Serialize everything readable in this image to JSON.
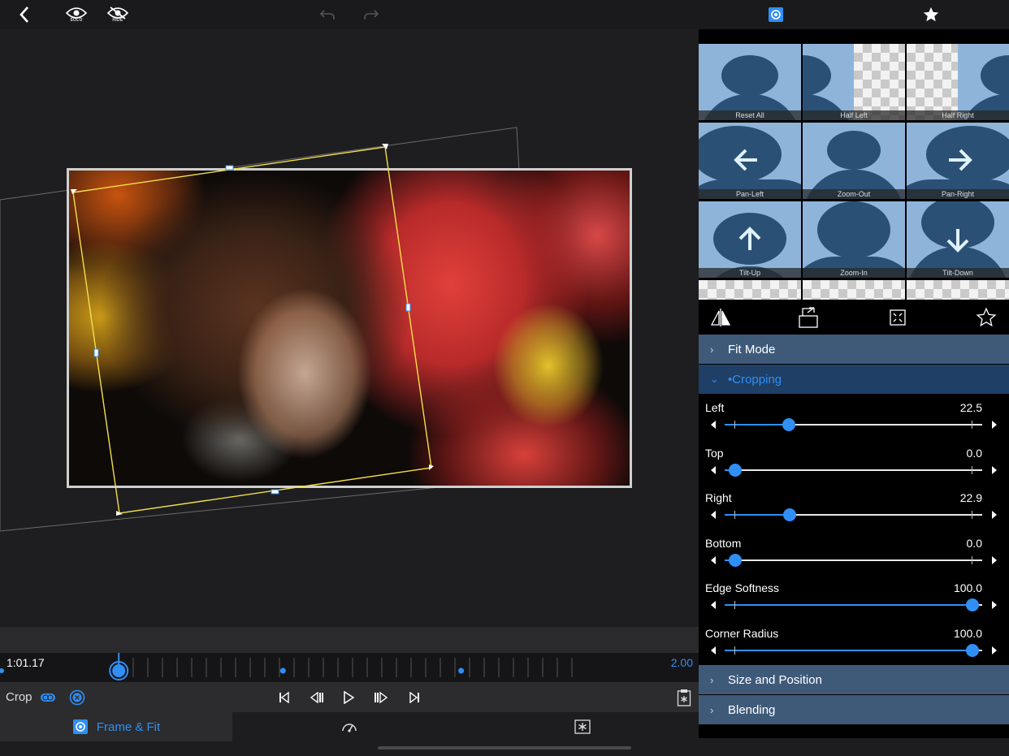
{
  "topbar": {
    "back": "back-chevron",
    "solo_label": "SOLO",
    "hide_label": "HIDE",
    "undo": "undo-arrow",
    "redo": "redo-arrow",
    "center_icon": "transform-target",
    "favorite_icon": "star"
  },
  "timeline": {
    "timecode": "1:01.17",
    "end_value": "2.00",
    "playhead_fraction": 0.17,
    "keyframes_fraction": [
      0.405,
      0.66
    ]
  },
  "controls": {
    "crop_label": "Crop",
    "transport": [
      "go-to-start",
      "step-back",
      "play",
      "step-forward",
      "go-to-end"
    ]
  },
  "tabs": [
    {
      "label": "Frame & Fit",
      "icon": "frame-fit-icon"
    },
    {
      "label": "",
      "icon": "speedometer-icon"
    },
    {
      "label": "",
      "icon": "effects-icon"
    }
  ],
  "presets": [
    {
      "label": "Reset All",
      "kind": "plain"
    },
    {
      "label": "Half Left",
      "kind": "half-left"
    },
    {
      "label": "Half Right",
      "kind": "half-right"
    },
    {
      "label": "Pan-Left",
      "kind": "arrow-left"
    },
    {
      "label": "Zoom-Out",
      "kind": "zoom-out"
    },
    {
      "label": "Pan-Right",
      "kind": "arrow-right"
    },
    {
      "label": "Tilt-Up",
      "kind": "arrow-up"
    },
    {
      "label": "Zoom-In",
      "kind": "zoom-in"
    },
    {
      "label": "Tilt-Down",
      "kind": "arrow-down"
    }
  ],
  "panel_icons": [
    "flip-icon",
    "rotate-icon",
    "fit-icon",
    "favorite-icon"
  ],
  "sections": {
    "fit_mode": "Fit Mode",
    "cropping": "•Cropping",
    "size_position": "Size and Position",
    "blending": "Blending"
  },
  "sliders": [
    {
      "name": "Left",
      "value": "22.5",
      "fraction": 0.25
    },
    {
      "name": "Top",
      "value": "0.0",
      "fraction": 0.04
    },
    {
      "name": "Right",
      "value": "22.9",
      "fraction": 0.253
    },
    {
      "name": "Bottom",
      "value": "0.0",
      "fraction": 0.04
    },
    {
      "name": "Edge Softness",
      "value": "100.0",
      "fraction": 0.961
    },
    {
      "name": "Corner Radius",
      "value": "100.0",
      "fraction": 0.961
    }
  ],
  "colors": {
    "accent": "#2f8ff5",
    "section": "#3f5a79",
    "crop_frame": "#f3e04a"
  }
}
